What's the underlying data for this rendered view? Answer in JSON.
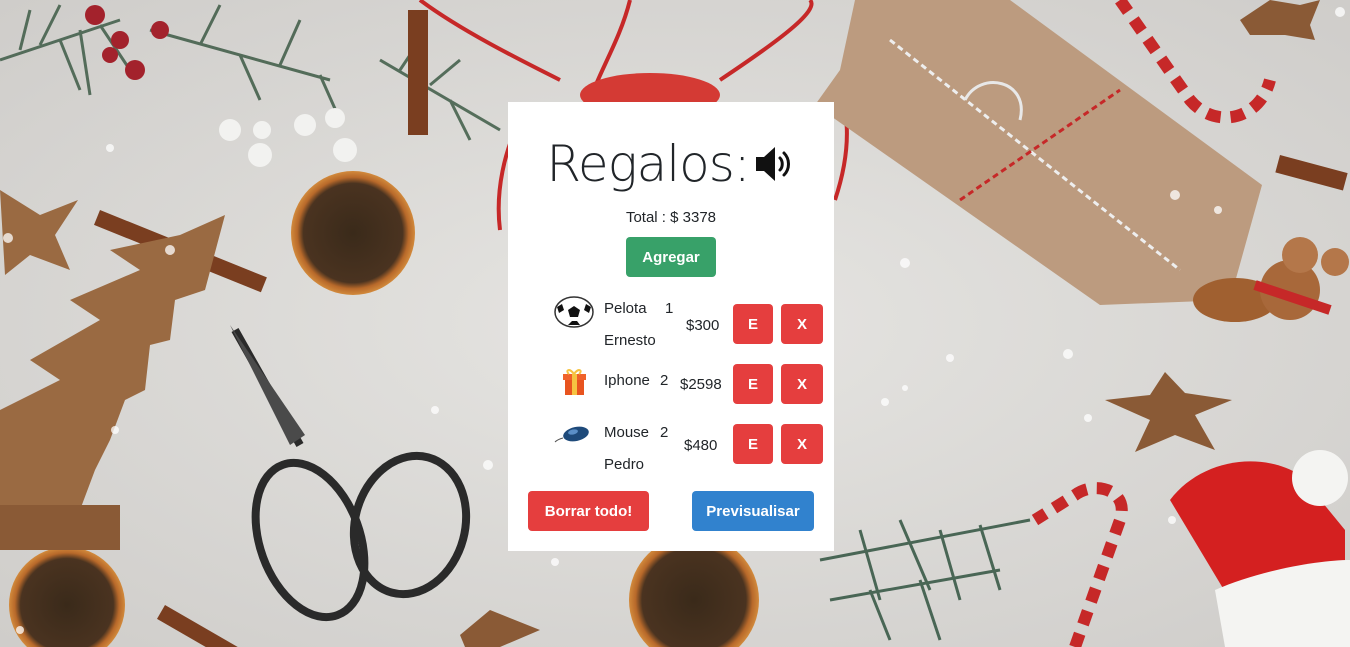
{
  "header": {
    "title": "Regalos:",
    "speaker_icon": "speaker-volume-icon"
  },
  "total": {
    "label": "Total : $ 3378"
  },
  "actions": {
    "add_label": "Agregar",
    "clear_label": "Borrar todo!",
    "preview_label": "Previsualisar"
  },
  "gifts": [
    {
      "icon": "soccer-ball-icon",
      "name": "Pelota",
      "qty": "1",
      "recipient": "Ernesto",
      "price": "$300",
      "edit_label": "E",
      "delete_label": "X"
    },
    {
      "icon": "gift-box-icon",
      "name": "Iphone",
      "qty": "2",
      "recipient": "",
      "price": "$2598",
      "edit_label": "E",
      "delete_label": "X"
    },
    {
      "icon": "computer-mouse-icon",
      "name": "Mouse",
      "qty": "2",
      "recipient": "Pedro",
      "price": "$480",
      "edit_label": "E",
      "delete_label": "X"
    }
  ],
  "colors": {
    "green": "#38a169",
    "red": "#e53e3e",
    "blue": "#3182ce"
  }
}
